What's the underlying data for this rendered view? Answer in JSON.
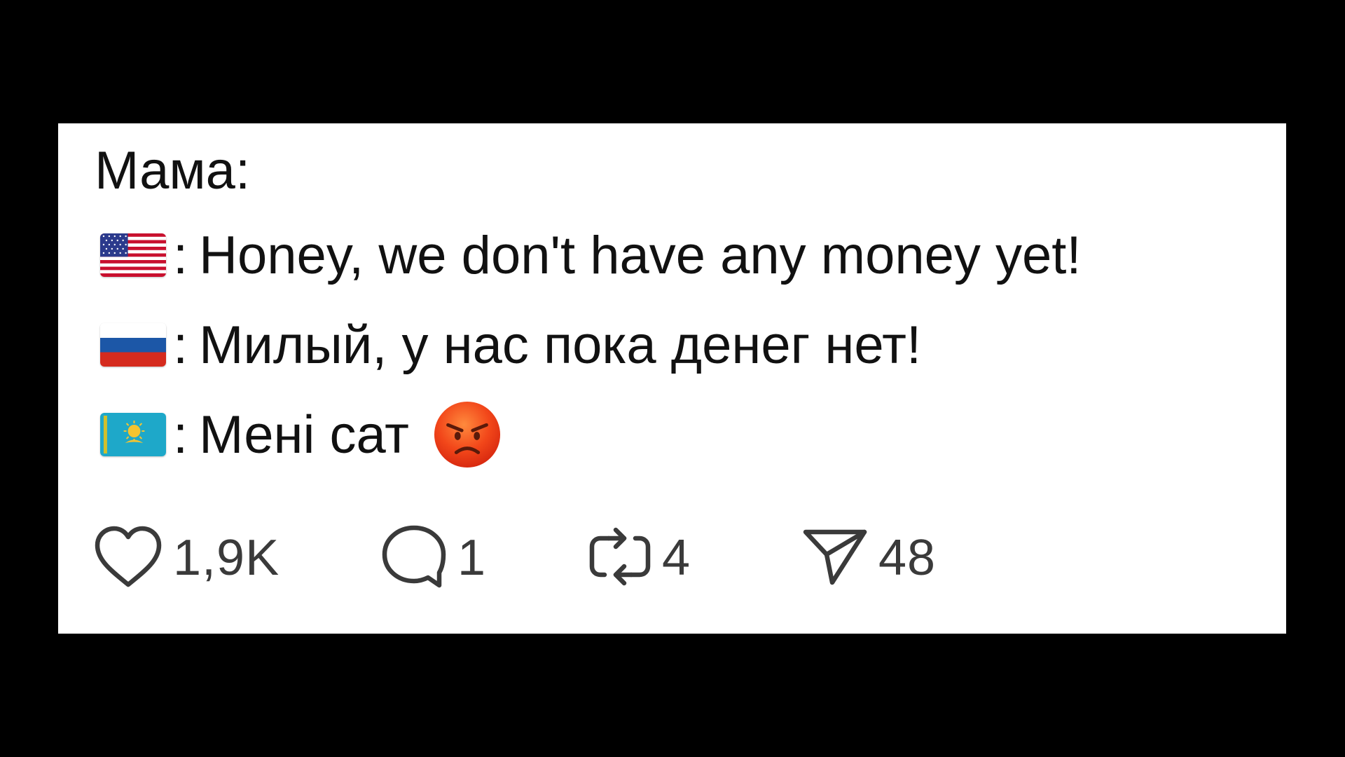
{
  "post": {
    "title": "Мама:",
    "lines": [
      {
        "flag": "us-flag",
        "separator": ":",
        "text": "Honey, we don't have any money yet!"
      },
      {
        "flag": "ru-flag",
        "separator": ":",
        "text": "Милый, у нас пока денег нет!"
      },
      {
        "flag": "kz-flag",
        "separator": ":",
        "text": "Мені сат",
        "emoji": "angry-face-emoji"
      }
    ]
  },
  "actions": {
    "like": {
      "icon": "heart-icon",
      "count": "1,9K"
    },
    "comment": {
      "icon": "comment-bubble-icon",
      "count": "1"
    },
    "repost": {
      "icon": "repost-icon",
      "count": "4"
    },
    "share": {
      "icon": "send-icon",
      "count": "48"
    }
  },
  "colors": {
    "page_background": "#000000",
    "card_background": "#ffffff",
    "text": "#111111",
    "icon": "#3a3a3a"
  }
}
